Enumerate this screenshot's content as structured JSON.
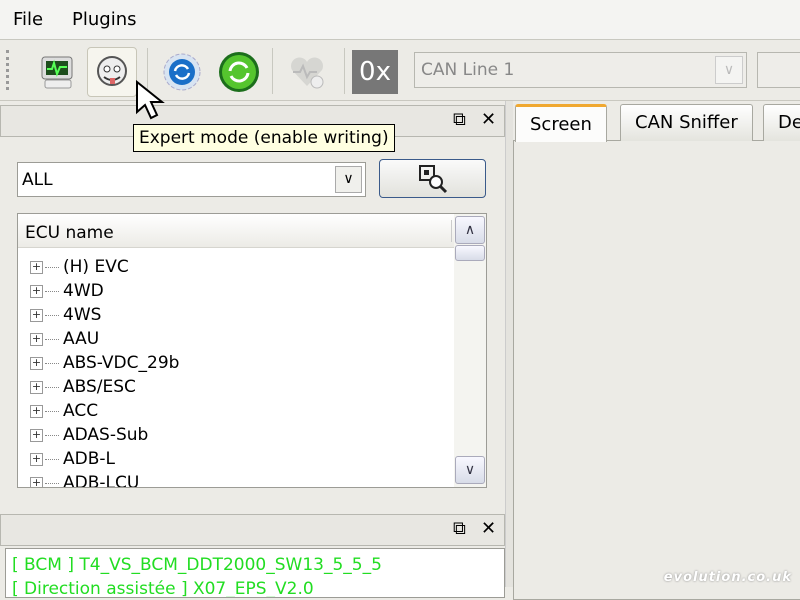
{
  "menu": {
    "file": "File",
    "plugins": "Plugins"
  },
  "toolbar": {
    "can_line": "CAN Line 1",
    "hex_label": "0x"
  },
  "tooltip": "Expert mode (enable writing)",
  "filter": {
    "selected": "ALL"
  },
  "tree": {
    "header": "ECU name",
    "items": [
      "(H) EVC",
      "4WD",
      "4WS",
      "AAU",
      "ABS-VDC_29b",
      "ABS/ESC",
      "ACC",
      "ADAS-Sub",
      "ADB-L",
      "ADB-LCU"
    ]
  },
  "tabs": [
    "Screen",
    "CAN Sniffer",
    "De"
  ],
  "log": [
    "[ BCM ] T4_VS_BCM_DDT2000_SW13_5_5_5",
    "[ Direction assistée ] X07_EPS_V2.0"
  ],
  "watermark": "evolution.co.uk",
  "colors": {
    "log_text": "#22dd22",
    "tab_accent": "#f0a830"
  }
}
